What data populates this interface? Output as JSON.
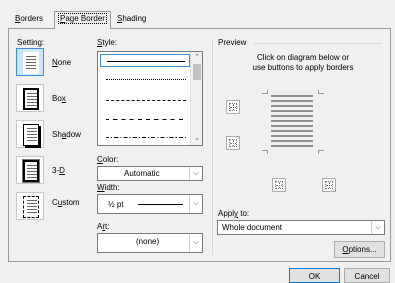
{
  "tabs": [
    {
      "label_pre": "",
      "accel": "B",
      "label_post": "orders"
    },
    {
      "label_pre": "",
      "accel": "P",
      "label_post": "age Border"
    },
    {
      "label_pre": "",
      "accel": "S",
      "label_post": "hading"
    }
  ],
  "setting": {
    "label": "Setting:",
    "options": [
      {
        "pre": "",
        "accel": "N",
        "post": "one"
      },
      {
        "pre": "Bo",
        "accel": "x",
        "post": ""
      },
      {
        "pre": "Sh",
        "accel": "a",
        "post": "dow"
      },
      {
        "pre": "3-",
        "accel": "D",
        "post": ""
      },
      {
        "pre": "C",
        "accel": "u",
        "post": "stom"
      }
    ]
  },
  "style": {
    "pre": "",
    "accel": "S",
    "post": "tyle:"
  },
  "color": {
    "pre": "",
    "accel": "C",
    "post": "olor:",
    "value": "Automatic"
  },
  "width": {
    "pre": "",
    "accel": "W",
    "post": "idth:",
    "value": "½ pt"
  },
  "art": {
    "pre": "A",
    "accel": "r",
    "post": "t:",
    "value": "(none)"
  },
  "preview": {
    "label": "Preview",
    "instruction_line1": "Click on diagram below or",
    "instruction_line2": "use buttons to apply borders"
  },
  "apply_to": {
    "pre": "Appl",
    "accel": "y",
    "post": " to:",
    "value": "Whole document"
  },
  "options_button": {
    "pre": "",
    "accel": "O",
    "post": "ptions..."
  },
  "ok_button": "OK",
  "cancel_button": "Cancel"
}
